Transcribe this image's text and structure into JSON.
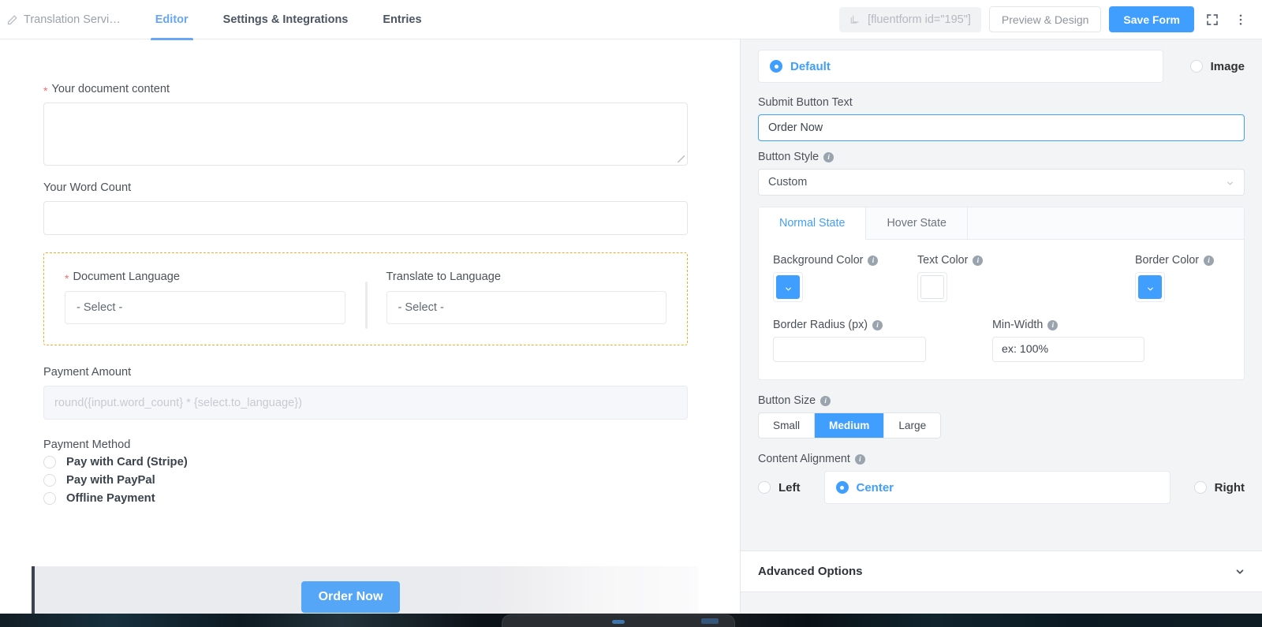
{
  "topbar": {
    "form_title": "Translation Servi…",
    "tabs": [
      {
        "label": "Editor",
        "active": true
      },
      {
        "label": "Settings & Integrations",
        "active": false
      },
      {
        "label": "Entries",
        "active": false
      }
    ],
    "shortcode": "[fluentform id=\"195\"]",
    "preview_label": "Preview & Design",
    "save_label": "Save Form",
    "fullscreen_icon": "expand-icon",
    "more_icon": "more-vertical-icon"
  },
  "form": {
    "document_content": {
      "label": "Your document content",
      "required": true,
      "value": ""
    },
    "word_count": {
      "label": "Your Word Count",
      "required": false,
      "value": ""
    },
    "container": {
      "left": {
        "label": "Document Language",
        "required": true,
        "value": "- Select -"
      },
      "right": {
        "label": "Translate to Language",
        "required": false,
        "value": "- Select -"
      }
    },
    "payment_amount": {
      "label": "Payment Amount",
      "placeholder": "round({input.word_count} * {select.to_language})",
      "value": ""
    },
    "payment_method": {
      "label": "Payment Method",
      "options": [
        {
          "label": "Pay with Card (Stripe)",
          "selected": false
        },
        {
          "label": "Pay with PayPal",
          "selected": false
        },
        {
          "label": "Offline Payment",
          "selected": false
        }
      ]
    },
    "submit_label": "Order Now"
  },
  "sidebar": {
    "button_type": {
      "options": [
        {
          "label": "Default",
          "selected": true
        },
        {
          "label": "Image",
          "selected": false
        }
      ]
    },
    "submit_button_text": {
      "label": "Submit Button Text",
      "value": "Order Now"
    },
    "button_style": {
      "label": "Button Style",
      "value": "Custom",
      "has_info": true
    },
    "state_tabs": [
      {
        "label": "Normal State",
        "active": true
      },
      {
        "label": "Hover State",
        "active": false
      }
    ],
    "colors": {
      "background": {
        "label": "Background Color",
        "value": "#409EFF",
        "has_info": true
      },
      "text": {
        "label": "Text Color",
        "value": "#FFFFFF",
        "has_info": true
      },
      "border": {
        "label": "Border Color",
        "value": "#409EFF",
        "has_info": true
      }
    },
    "border_radius": {
      "label": "Border Radius (px)",
      "value": "",
      "placeholder": "",
      "has_info": true
    },
    "min_width": {
      "label": "Min-Width",
      "value": "ex: 100%",
      "has_info": true
    },
    "button_size": {
      "label": "Button Size",
      "has_info": true,
      "options": [
        {
          "label": "Small",
          "selected": false
        },
        {
          "label": "Medium",
          "selected": true
        },
        {
          "label": "Large",
          "selected": false
        }
      ]
    },
    "content_alignment": {
      "label": "Content Alignment",
      "has_info": true,
      "options": [
        {
          "label": "Left",
          "selected": false
        },
        {
          "label": "Center",
          "selected": true
        },
        {
          "label": "Right",
          "selected": false
        }
      ]
    },
    "advanced_options": {
      "label": "Advanced Options",
      "expanded": false
    }
  },
  "theme": {
    "accent": "#409EFF",
    "accent_light": "#67A7F5",
    "required": "#F56C6C",
    "container_dash": "#F2AD28",
    "sidebar_bg": "#F3F4F6"
  }
}
